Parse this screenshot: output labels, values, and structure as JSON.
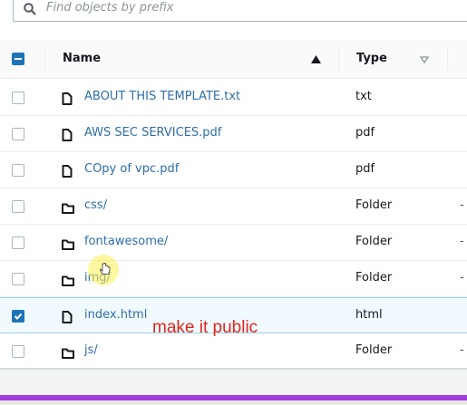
{
  "search": {
    "placeholder": "Find objects by prefix"
  },
  "table": {
    "columns": [
      {
        "label": "Name",
        "sort": "ascending"
      },
      {
        "label": "Type",
        "sort": "none"
      }
    ],
    "rows": [
      {
        "name": "ABOUT THIS TEMPLATE.txt",
        "type": "txt",
        "kind": "file",
        "selected": false,
        "extra": ""
      },
      {
        "name": "AWS SEC SERVICES.pdf",
        "type": "pdf",
        "kind": "file",
        "selected": false,
        "extra": ""
      },
      {
        "name": "COpy of vpc.pdf",
        "type": "pdf",
        "kind": "file",
        "selected": false,
        "extra": ""
      },
      {
        "name": "css/",
        "type": "Folder",
        "kind": "folder",
        "selected": false,
        "extra": "-"
      },
      {
        "name": "fontawesome/",
        "type": "Folder",
        "kind": "folder",
        "selected": false,
        "extra": "-"
      },
      {
        "name": "img/",
        "type": "Folder",
        "kind": "folder",
        "selected": false,
        "extra": "-"
      },
      {
        "name": "index.html",
        "type": "html",
        "kind": "file",
        "selected": true,
        "extra": ""
      },
      {
        "name": "js/",
        "type": "Folder",
        "kind": "folder",
        "selected": false,
        "extra": "-"
      }
    ]
  },
  "annotation": "make it public",
  "colors": {
    "accent": "#1f74b8",
    "link": "#2f6ea8",
    "annotation": "#e1261c",
    "bar": "#a23de0"
  }
}
